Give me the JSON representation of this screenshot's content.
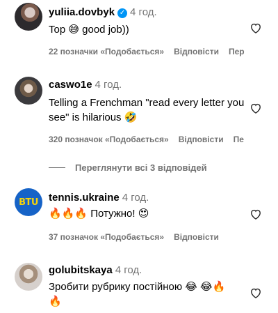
{
  "comments": [
    {
      "username": "yuliia.dovbyk",
      "verified": true,
      "time": "4 год.",
      "text": "Top 😅 good job))",
      "likes": "22 позначки «Подобається»",
      "reply": "Відповісти",
      "extra": "Пер"
    },
    {
      "username": "caswo1e",
      "time": "4 год.",
      "text": "Telling a Frenchman \"read every letter you see\" is hilarious 🤣",
      "likes": "320 позначок «Подобається»",
      "reply": "Відповісти",
      "extra": "Пе"
    },
    {
      "username": "tennis.ukraine",
      "time": "4 год.",
      "text": "🔥🔥🔥 Потужно! 😍",
      "likes": "37 позначок «Подобається»",
      "reply": "Відповісти",
      "avatar_text": "BTU"
    },
    {
      "username": "golubitskaya",
      "time": "4 год.",
      "text": "Зробити рубрику постійною 😂 😂🔥🔥"
    }
  ],
  "view_replies": "Переглянути всі 3 відповідей",
  "icons": {
    "like": "heart-icon",
    "verified": "verified-badge-icon"
  },
  "colors": {
    "secondary_text": "#737373",
    "verified": "#0095f6"
  }
}
